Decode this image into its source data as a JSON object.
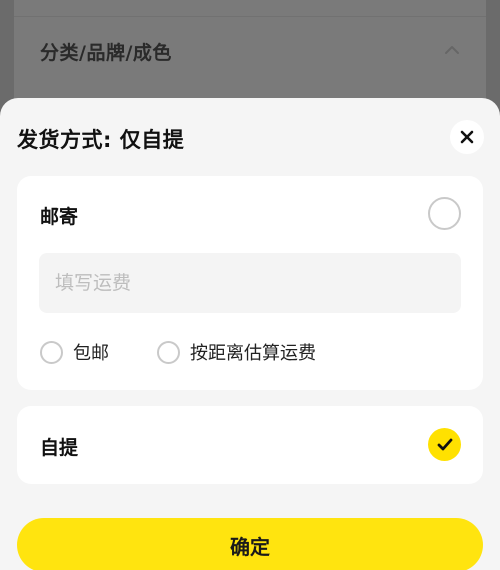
{
  "background": {
    "row_label": "分类/品牌/成色"
  },
  "sheet": {
    "title": "发货方式: 仅自提",
    "options": {
      "mail": {
        "label": "邮寄",
        "selected": false,
        "fee_input": {
          "value": "",
          "placeholder": "填写运费"
        },
        "sub_options": [
          {
            "label": "包邮",
            "selected": false
          },
          {
            "label": "按距离估算运费",
            "selected": false
          }
        ]
      },
      "pickup": {
        "label": "自提",
        "selected": true
      }
    },
    "confirm_label": "确定"
  },
  "colors": {
    "accent": "#FFE40F",
    "overlay": "#6B6B6B",
    "sheet_bg": "#F5F5F5"
  }
}
